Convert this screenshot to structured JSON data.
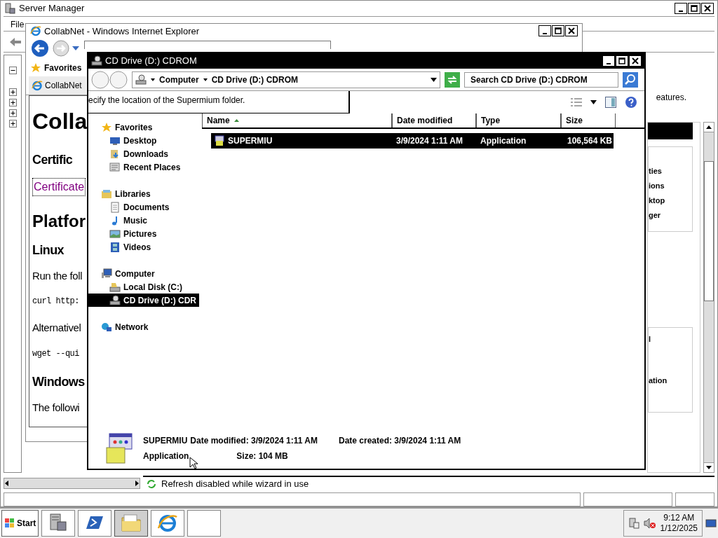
{
  "server_manager": {
    "title": "Server Manager",
    "menu": [
      "File"
    ],
    "tree": [
      {
        "expanded": true
      },
      {
        "expanded": false
      },
      {
        "expanded": false
      },
      {
        "expanded": false
      },
      {
        "expanded": false
      }
    ],
    "right_pane": {
      "intro": "eatures.",
      "list_a": [
        "ties",
        "ions",
        "ktop",
        "ger"
      ],
      "list_b": [
        "l",
        "ation"
      ]
    },
    "status": "Refresh disabled while wizard in use"
  },
  "browser": {
    "title": "CollabNet - Windows Internet Explorer",
    "favorites": "Favorites",
    "tab": "CollabNet",
    "page": [
      {
        "kind": "h1",
        "text": "Colla"
      },
      {
        "kind": "h2",
        "text": "Certific"
      },
      {
        "kind": "link",
        "text": "Certificate"
      },
      {
        "kind": "h1b",
        "text": "Platfor"
      },
      {
        "kind": "h2",
        "text": "Linux"
      },
      {
        "kind": "p",
        "text": "Run the foll"
      },
      {
        "kind": "code",
        "text": "curl http:"
      },
      {
        "kind": "p",
        "text": "Alternativel"
      },
      {
        "kind": "code",
        "text": "wget --qui"
      },
      {
        "kind": "h2",
        "text": "Windows"
      },
      {
        "kind": "p",
        "text": "The followi"
      }
    ]
  },
  "explorer": {
    "title": "CD Drive (D:) CDROM",
    "breadcrumb": [
      "Computer",
      "CD Drive (D:) CDROM"
    ],
    "search": {
      "placeholder": "Search CD Drive (D:) CDROM"
    },
    "wizard_text": "ecify the location of the Supermium folder.",
    "nav": [
      {
        "label": "Favorites",
        "kind": "star",
        "selected": false,
        "children": [
          {
            "label": "Desktop",
            "kind": "desktop",
            "selected": false
          },
          {
            "label": "Downloads",
            "kind": "downloads",
            "selected": false
          },
          {
            "label": "Recent Places",
            "kind": "recent",
            "selected": false
          }
        ]
      },
      {
        "label": "Libraries",
        "kind": "libraries",
        "selected": false,
        "children": [
          {
            "label": "Documents",
            "kind": "document",
            "selected": false
          },
          {
            "label": "Music",
            "kind": "music",
            "selected": false
          },
          {
            "label": "Pictures",
            "kind": "picture",
            "selected": false
          },
          {
            "label": "Videos",
            "kind": "video",
            "selected": false
          }
        ]
      },
      {
        "label": "Computer",
        "kind": "computer",
        "selected": false,
        "children": [
          {
            "label": "Local Disk (C:)",
            "kind": "disk",
            "selected": false
          },
          {
            "label": "CD Drive (D:) CDR",
            "kind": "cd",
            "selected": true
          }
        ]
      },
      {
        "label": "Network",
        "kind": "network",
        "selected": false
      }
    ],
    "columns": [
      {
        "label": "Name",
        "sorted": true
      },
      {
        "label": "Date modified",
        "sorted": false
      },
      {
        "label": "Type",
        "sorted": false
      },
      {
        "label": "Size",
        "sorted": false
      }
    ],
    "files": [
      {
        "name": "SUPERMIU",
        "modified": "3/9/2024 1:11 AM",
        "type": "Application",
        "size": "106,564 KB",
        "selected": true
      }
    ],
    "details": {
      "name": "SUPERMIU",
      "modified": "Date modified: 3/9/2024 1:11 AM",
      "created": "Date created: 3/9/2024 1:11 AM",
      "type": "Application",
      "size": "Size: 104 MB"
    }
  },
  "taskbar": {
    "start": "Start",
    "buttons": [
      {
        "kind": "server",
        "selected": false
      },
      {
        "kind": "shell",
        "selected": false
      },
      {
        "kind": "folder",
        "selected": true
      },
      {
        "kind": "browser",
        "selected": false
      },
      {
        "kind": "blank",
        "selected": false
      }
    ],
    "time": "9:12 AM",
    "date": "1/12/2025"
  }
}
